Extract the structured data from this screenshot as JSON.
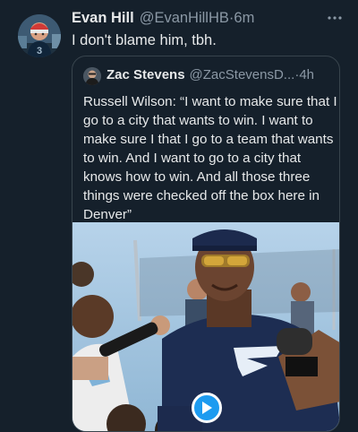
{
  "tweet": {
    "display_name": "Evan Hill",
    "handle": "@EvanHillHB",
    "separator": " · ",
    "time": "6m",
    "more_icon": "more-horizontal-icon",
    "text": "I don't blame him, tbh."
  },
  "quoted_tweet": {
    "display_name": "Zac Stevens",
    "handle": "@ZacStevensD...",
    "separator": " · ",
    "time": "4h",
    "text": "Russell Wilson: “I want to make sure that I go to a city that wants to win. I want to make sure I that I go to a team that wants to win. And I want to go to a city that knows how to win. And all those three things were checked off the box here in Denver”",
    "media": {
      "type": "video",
      "play_icon": "play-icon"
    }
  },
  "colors": {
    "background": "#15202b",
    "text_primary": "#e7e9ea",
    "text_secondary": "#8b98a5",
    "border": "#38444d",
    "accent": "#1d9bf0"
  }
}
